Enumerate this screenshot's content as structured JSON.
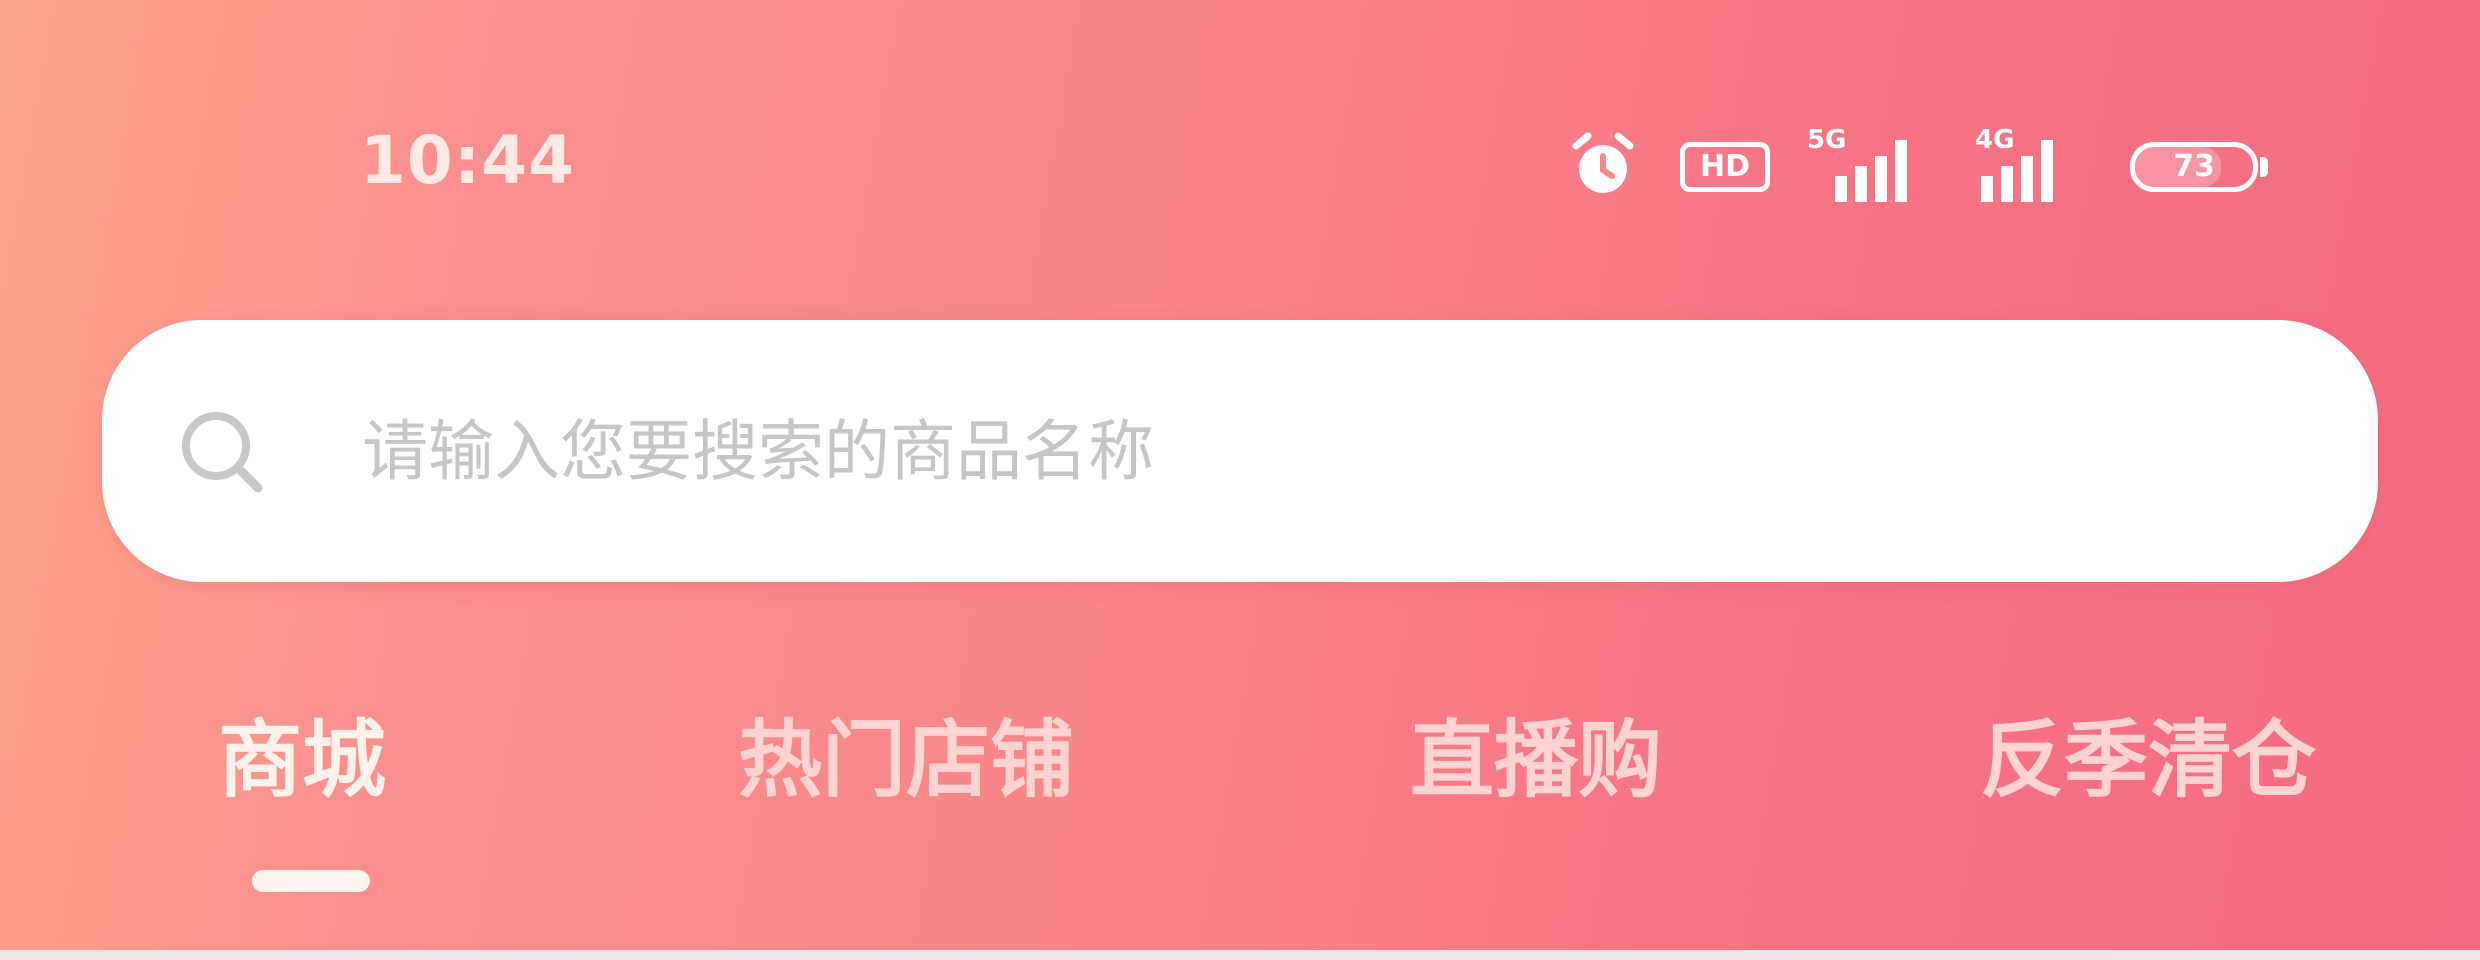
{
  "status_bar": {
    "time": "10:44",
    "hd_label": "HD",
    "signal_1_label": "5G",
    "signal_2_label": "4G",
    "battery_level": "73",
    "icons": [
      "alarm-icon",
      "hd-icon",
      "signal-5g-icon",
      "signal-4g-icon",
      "battery-icon"
    ]
  },
  "search": {
    "placeholder": "请输入您要搜索的商品名称",
    "value": "",
    "icon": "search-icon"
  },
  "tabs": [
    {
      "label": "商城",
      "active": true
    },
    {
      "label": "热门店铺",
      "active": false
    },
    {
      "label": "直播购",
      "active": false
    },
    {
      "label": "反季清仓",
      "active": false
    }
  ],
  "colors": {
    "gradient_start": "#fca58a",
    "gradient_end": "#f56a80",
    "search_bg": "#ffffff",
    "placeholder": "#c6c6c6",
    "tab_active": "#fff2ea",
    "tab_inactive": "#ffd3cf"
  }
}
